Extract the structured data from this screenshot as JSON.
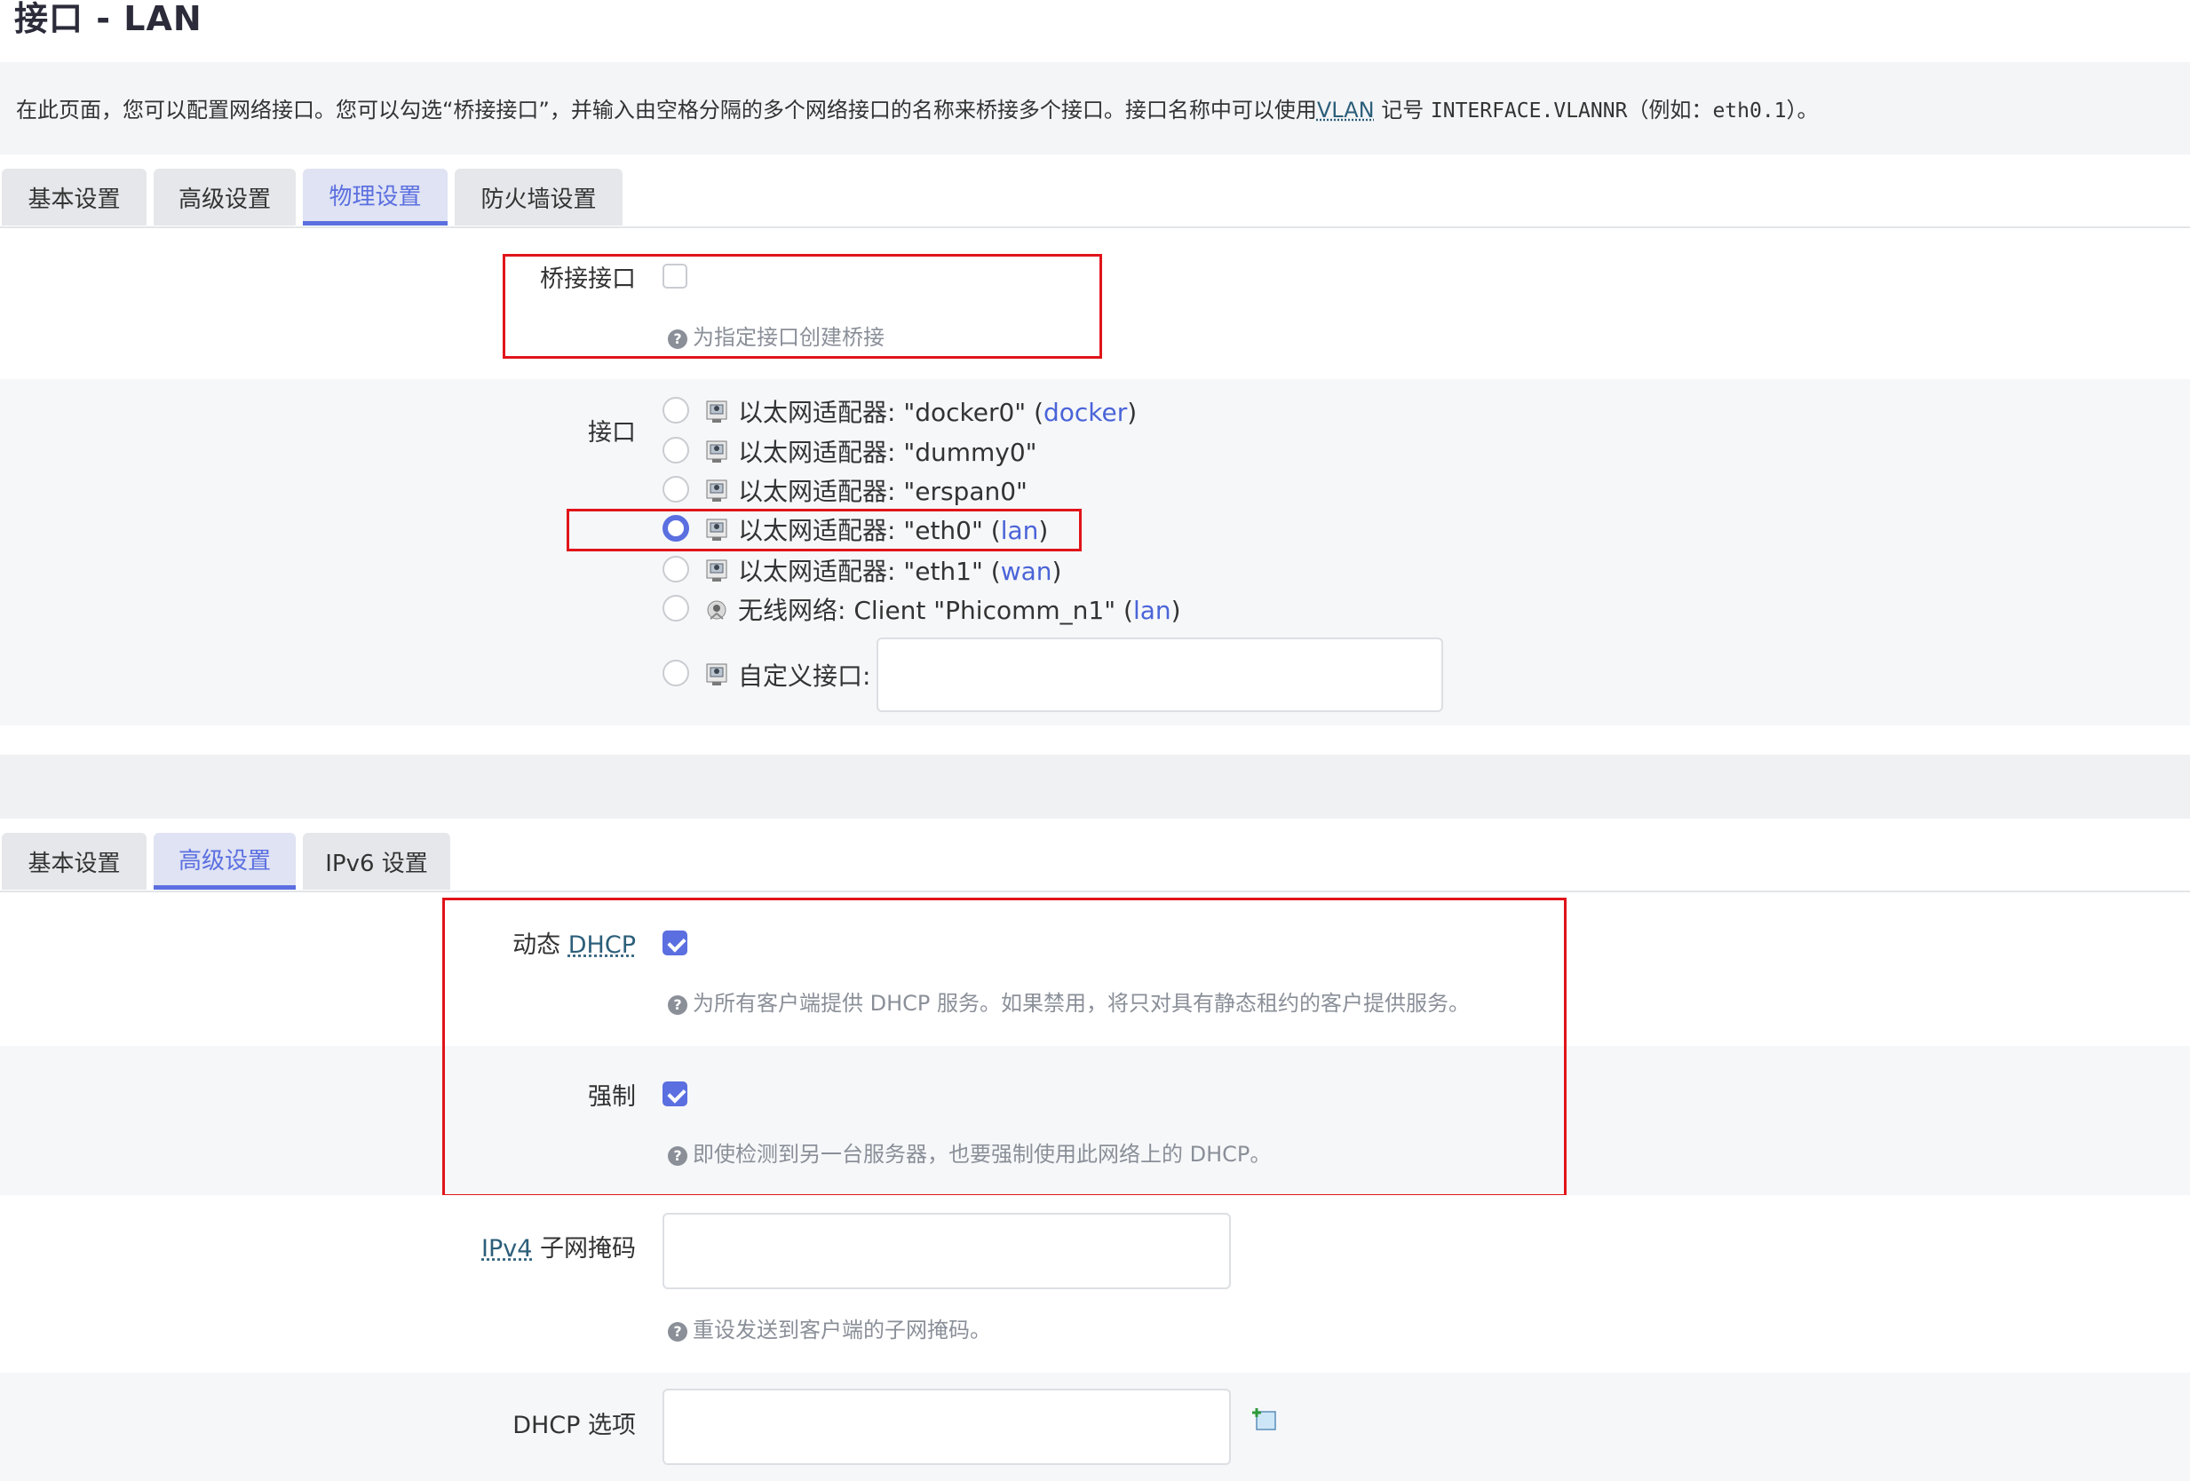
{
  "page": {
    "title": "接口 - LAN"
  },
  "description": {
    "part1": "在此页面，您可以配置网络接口。您可以勾选“桥接接口”，并输入由空格分隔的多个网络接口的名称来桥接多个接口。接口名称中可以使用",
    "vlan": "VLAN",
    "part2": "记号",
    "code1": "INTERFACE.VLANNR",
    "part3": "（例如：",
    "code2": "eth0.1",
    "part4": "）。"
  },
  "tabs_top": [
    {
      "label": "基本设置",
      "active": false
    },
    {
      "label": "高级设置",
      "active": false
    },
    {
      "label": "物理设置",
      "active": true
    },
    {
      "label": "防火墙设置",
      "active": false
    }
  ],
  "bridge": {
    "label": "桥接接口",
    "checked": false,
    "hint": "为指定接口创建桥接"
  },
  "interface": {
    "label": "接口",
    "options": [
      {
        "text": "以太网适配器: \"docker0\"",
        "network": "docker",
        "checked": false,
        "icon": "ethernet-icon"
      },
      {
        "text": "以太网适配器: \"dummy0\"",
        "network": "",
        "checked": false,
        "icon": "ethernet-icon"
      },
      {
        "text": "以太网适配器: \"erspan0\"",
        "network": "",
        "checked": false,
        "icon": "ethernet-icon"
      },
      {
        "text": "以太网适配器: \"eth0\"",
        "network": "lan",
        "checked": true,
        "icon": "ethernet-icon"
      },
      {
        "text": "以太网适配器: \"eth1\"",
        "network": "wan",
        "checked": false,
        "icon": "ethernet-icon"
      },
      {
        "text": "无线网络: Client \"Phicomm_n1\"",
        "network": "lan",
        "checked": false,
        "icon": "wifi-icon"
      }
    ],
    "custom_label": "自定义接口:",
    "custom_value": ""
  },
  "tabs_bottom": [
    {
      "label": "基本设置",
      "active": false
    },
    {
      "label": "高级设置",
      "active": true
    },
    {
      "label": "IPv6 设置",
      "active": false
    }
  ],
  "dhcp": {
    "dynamic_label_prefix": "动态",
    "dynamic_label_abbr": "DHCP",
    "dynamic_checked": true,
    "dynamic_hint": "为所有客户端提供 DHCP 服务。如果禁用，将只对具有静态租约的客户提供服务。",
    "force_label": "强制",
    "force_checked": true,
    "force_hint": "即使检测到另一台服务器，也要强制使用此网络上的 DHCP。",
    "netmask_label_abbr": "IPv4",
    "netmask_label_rest": "子网掩码",
    "netmask_value": "",
    "netmask_hint": "重设发送到客户端的子网掩码。",
    "options_label": "DHCP 选项",
    "options_value": ""
  },
  "colors": {
    "accent": "#5b6fe0",
    "highlight": "#e0141a",
    "link": "#4a64d8"
  }
}
